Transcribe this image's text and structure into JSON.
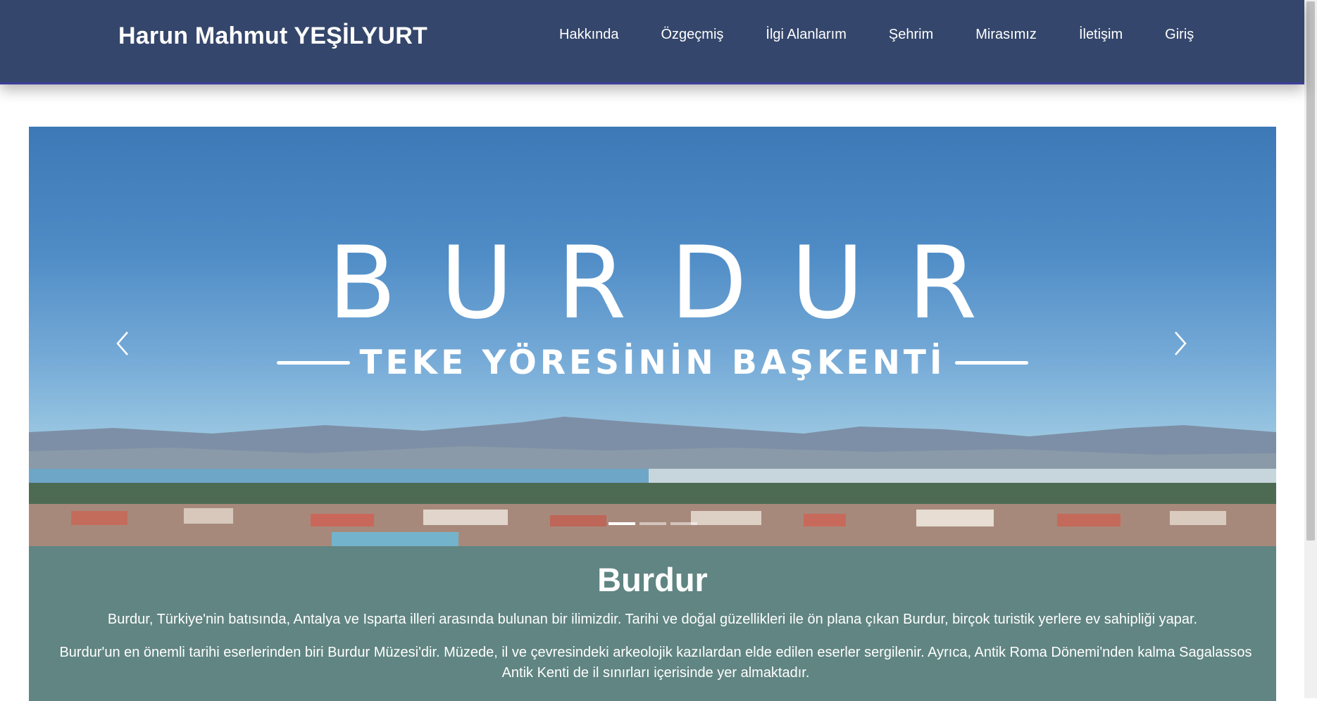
{
  "header": {
    "brand": "Harun Mahmut YEŞİLYURT",
    "nav": [
      {
        "label": "Hakkında"
      },
      {
        "label": "Özgeçmiş"
      },
      {
        "label": "İlgi Alanlarım"
      },
      {
        "label": "Şehrim"
      },
      {
        "label": "Mirasımız"
      },
      {
        "label": "İletişim"
      },
      {
        "label": "Giriş"
      }
    ]
  },
  "carousel": {
    "headline": "BURDUR",
    "subtitle": "TEKE YÖRESİNİN BAŞKENTİ",
    "prev_icon": "chevron-left-icon",
    "next_icon": "chevron-right-icon",
    "slide_count": 3,
    "active_slide": 1
  },
  "caption": {
    "title": "Burdur",
    "paragraph1": "Burdur, Türkiye'nin batısında, Antalya ve Isparta illeri arasında bulunan bir ilimizdir. Tarihi ve doğal güzellikleri ile ön plana çıkan Burdur, birçok turistik yerlere ev sahipliği yapar.",
    "paragraph2": "Burdur'un en önemli tarihi eserlerinden biri Burdur Müzesi'dir. Müzede, il ve çevresindeki arkeolojik kazılardan elde edilen eserler sergilenir. Ayrıca, Antik Roma Dönemi'nden kalma Sagalassos Antik Kenti de il sınırları içerisinde yer almaktadır."
  },
  "colors": {
    "navbar": "#34466b",
    "caption_bg": "#608582",
    "text_light": "#ffffff"
  }
}
